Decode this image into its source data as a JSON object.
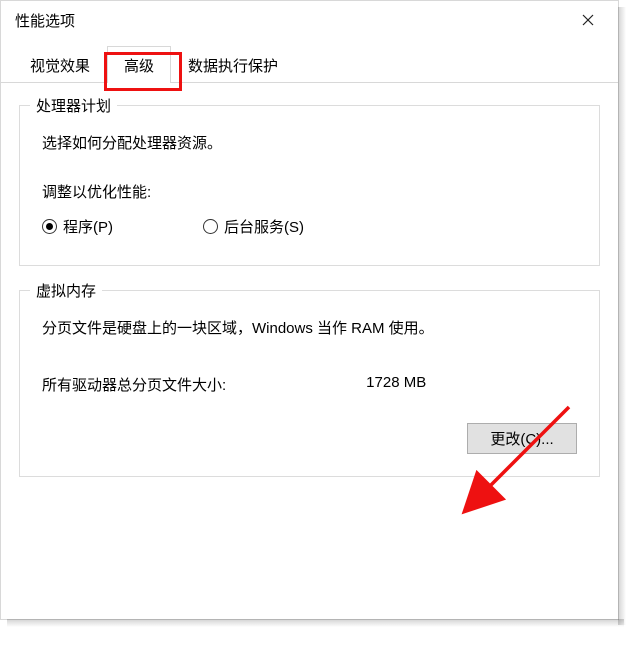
{
  "title": "性能选项",
  "tabs": {
    "visual": "视觉效果",
    "advanced": "高级",
    "dep": "数据执行保护"
  },
  "processor": {
    "legend": "处理器计划",
    "desc": "选择如何分配处理器资源。",
    "subhead": "调整以优化性能:",
    "option_programs": "程序(P)",
    "option_services": "后台服务(S)"
  },
  "vm": {
    "legend": "虚拟内存",
    "desc": "分页文件是硬盘上的一块区域，Windows 当作 RAM 使用。",
    "total_label": "所有驱动器总分页文件大小:",
    "total_value": "1728 MB",
    "change_btn": "更改(C)..."
  }
}
